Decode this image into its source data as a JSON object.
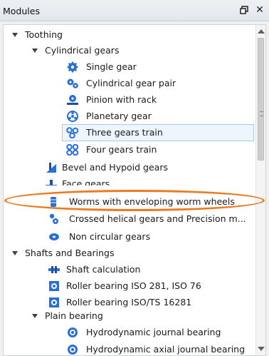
{
  "panel": {
    "title": "Modules",
    "float_icon": "dock-float-icon",
    "close_icon": "close-icon"
  },
  "tree": {
    "toothing": "Toothing",
    "cylindrical": "Cylindrical gears",
    "single_gear": "Single gear",
    "gear_pair": "Cylindrical gear pair",
    "pinion_rack": "Pinion with rack",
    "planetary": "Planetary gear",
    "three_train": "Three gears train",
    "four_train": "Four gears train",
    "bevel": "Bevel and Hypoid gears",
    "face": "Face gears",
    "worms": "Worms with enveloping worm wheels",
    "crossed": "Crossed helical gears and Precision m...",
    "non_circular": "Non circular gears",
    "shafts": "Shafts and Bearings",
    "shaft_calc": "Shaft calculation",
    "roller_281": "Roller bearing ISO 281, ISO 76",
    "roller_16281": "Roller bearing ISO/TS 16281",
    "plain": "Plain bearing",
    "hydro_journal": "Hydrodynamic journal bearing",
    "hydro_axial": "Hydrodynamic axial journal bearing"
  },
  "colors": {
    "selection": "#eef5fd",
    "annotation": "#ec7a1f",
    "icon_blue": "#2a6fd6"
  }
}
